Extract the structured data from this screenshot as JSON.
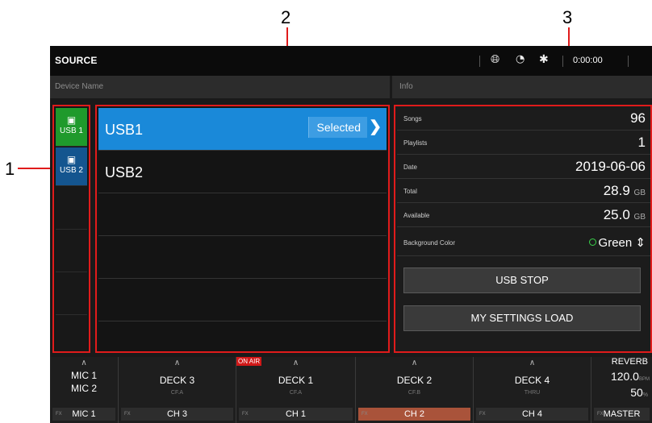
{
  "callouts": {
    "c1": "1",
    "c2": "2",
    "c3": "3"
  },
  "topbar": {
    "title": "SOURCE",
    "icons": [
      "globe-icon",
      "wifi-icon",
      "bluetooth-icon"
    ],
    "time": "0:00:00"
  },
  "subheader": {
    "left": "Device Name",
    "right": "Info"
  },
  "usb_tabs": [
    {
      "label": "USB 1",
      "color": "#1f9a2c"
    },
    {
      "label": "USB 2",
      "color": "#14558f"
    }
  ],
  "devices": [
    {
      "name": "USB1",
      "badge": "Selected"
    },
    {
      "name": "USB2"
    }
  ],
  "info": {
    "songs": {
      "label": "Songs",
      "value": "96"
    },
    "playlists": {
      "label": "Playlists",
      "value": "1"
    },
    "date": {
      "label": "Date",
      "value": "2019-06-06"
    },
    "total": {
      "label": "Total",
      "value": "28.9",
      "unit": "GB"
    },
    "available": {
      "label": "Available",
      "value": "25.0",
      "unit": "GB"
    },
    "background": {
      "label": "Background Color",
      "value": "Green"
    },
    "btn_usb_stop": "USB STOP",
    "btn_load": "MY SETTINGS LOAD"
  },
  "mixer": {
    "on_air": "ON AIR",
    "fx_label": "FX",
    "channels": [
      {
        "name": "MIC 1",
        "name2": "MIC 2",
        "sub": "",
        "assign": "MIC 1"
      },
      {
        "name": "DECK 3",
        "sub": "CF.A",
        "assign": "CH 3"
      },
      {
        "name": "DECK 1",
        "sub": "CF.A",
        "assign": "CH 1"
      },
      {
        "name": "DECK 2",
        "sub": "CF.B",
        "assign": "CH 2"
      },
      {
        "name": "DECK 4",
        "sub": "THRU",
        "assign": "CH 4"
      }
    ],
    "fx": {
      "name": "REVERB",
      "bpm": "120.0",
      "bpm_unit": "BPM",
      "level": "50",
      "level_unit": "%",
      "assign": "MASTER"
    }
  }
}
